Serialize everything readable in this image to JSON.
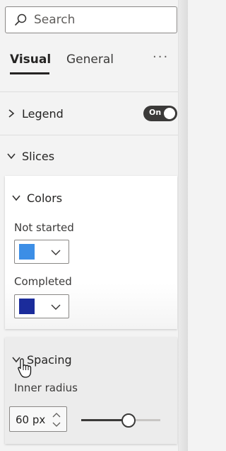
{
  "search": {
    "placeholder": "Search"
  },
  "tabs": [
    {
      "label": "Visual",
      "active": true
    },
    {
      "label": "General",
      "active": false
    }
  ],
  "more": "···",
  "sections": {
    "legend": {
      "label": "Legend",
      "expanded": false,
      "toggle": "On"
    },
    "slices": {
      "label": "Slices",
      "expanded": true
    }
  },
  "colors_card": {
    "label": "Colors",
    "items": [
      {
        "label": "Not started",
        "color": "#3c8ee6"
      },
      {
        "label": "Completed",
        "color": "#1b2c9b"
      }
    ]
  },
  "spacing_card": {
    "label": "Spacing",
    "inner_radius_label": "Inner radius",
    "inner_radius_value": "60",
    "inner_radius_unit": "px",
    "slider_fraction": 0.6
  }
}
